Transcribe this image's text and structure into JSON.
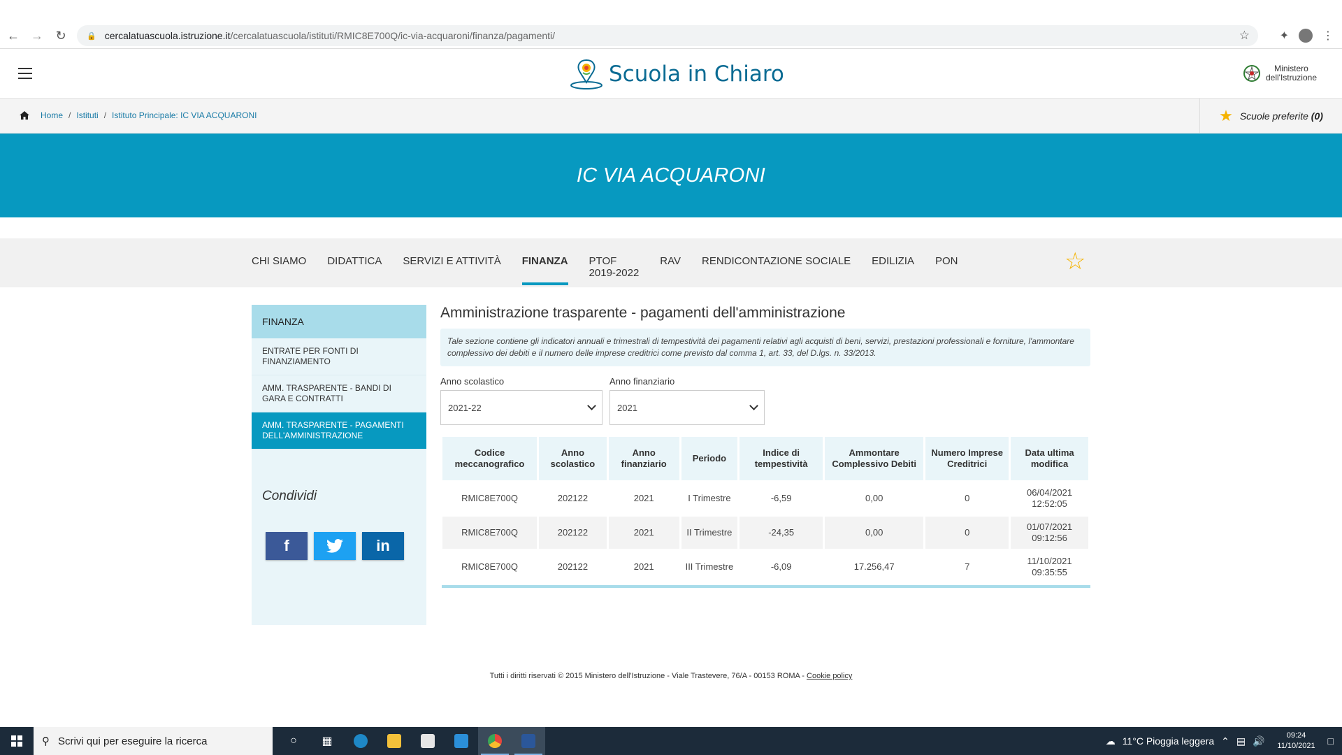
{
  "browser": {
    "url_host": "cercalatuascuola.istruzione.it",
    "url_path": "/cercalatuascuola/istituti/RMIC8E700Q/ic-via-acquaroni/finanza/pagamenti/"
  },
  "header": {
    "logo_text": "Scuola in Chiaro",
    "ministry_line1": "Ministero",
    "ministry_line2": "dell'Istruzione"
  },
  "breadcrumb": {
    "items": [
      "Home",
      "Istituti",
      "Istituto Principale: IC VIA ACQUARONI"
    ],
    "separator": "/"
  },
  "favorites": {
    "label": "Scuole preferite",
    "count": "(0)"
  },
  "hero": {
    "title": "IC VIA ACQUARONI"
  },
  "tabs": [
    {
      "label": "CHI SIAMO"
    },
    {
      "label": "DIDATTICA"
    },
    {
      "label": "SERVIZI E ATTIVITÀ"
    },
    {
      "label": "FINANZA"
    },
    {
      "label": "PTOF",
      "label2": "2019-2022"
    },
    {
      "label": "RAV"
    },
    {
      "label": "RENDICONTAZIONE SOCIALE"
    },
    {
      "label": "EDILIZIA"
    },
    {
      "label": "PON"
    }
  ],
  "sidebar": {
    "heading": "FINANZA",
    "items": [
      {
        "label": "ENTRATE PER FONTI DI FINANZIAMENTO"
      },
      {
        "label": "AMM. TRASPARENTE - BANDI DI GARA E CONTRATTI"
      },
      {
        "label": "AMM. TRASPARENTE - PAGAMENTI DELL'AMMINISTRAZIONE"
      }
    ],
    "share_title": "Condividi",
    "share": {
      "facebook": "f",
      "twitter": "t",
      "linkedin": "in"
    }
  },
  "main": {
    "title": "Amministrazione trasparente - pagamenti dell'amministrazione",
    "info": "Tale sezione contiene gli indicatori annuali e trimestrali di tempestività dei pagamenti relativi agli acquisti di beni, servizi, prestazioni professionali e forniture, l'ammontare complessivo dei debiti e il numero delle imprese creditrici come previsto dal comma 1, art. 33, del D.lgs. n. 33/2013.",
    "filter_school_label": "Anno scolastico",
    "filter_school_value": "2021-22",
    "filter_fin_label": "Anno finanziario",
    "filter_fin_value": "2021"
  },
  "table": {
    "headers": [
      "Codice meccanografico",
      "Anno scolastico",
      "Anno finanziario",
      "Periodo",
      "Indice di tempestività",
      "Ammontare Complessivo Debiti",
      "Numero Imprese Creditrici",
      "Data ultima modifica"
    ],
    "rows": [
      [
        "RMIC8E700Q",
        "202122",
        "2021",
        "I Trimestre",
        "-6,59",
        "0,00",
        "0",
        "06/04/2021 12:52:05"
      ],
      [
        "RMIC8E700Q",
        "202122",
        "2021",
        "II Trimestre",
        "-24,35",
        "0,00",
        "0",
        "01/07/2021 09:12:56"
      ],
      [
        "RMIC8E700Q",
        "202122",
        "2021",
        "III Trimestre",
        "-6,09",
        "17.256,47",
        "7",
        "11/10/2021 09:35:55"
      ]
    ]
  },
  "footer": {
    "text": "Tutti i diritti riservati © 2015 Ministero dell'Istruzione - Viale Trastevere, 76/A - 00153 ROMA - ",
    "cookie": "Cookie policy"
  },
  "taskbar": {
    "search_placeholder": "Scrivi qui per eseguire la ricerca",
    "weather": "11°C  Pioggia leggera",
    "time": "09:24",
    "date": "11/10/2021"
  },
  "colors": {
    "brand": "#0799c0",
    "sidebar_head": "#a8dcea",
    "star": "#f5b301"
  }
}
